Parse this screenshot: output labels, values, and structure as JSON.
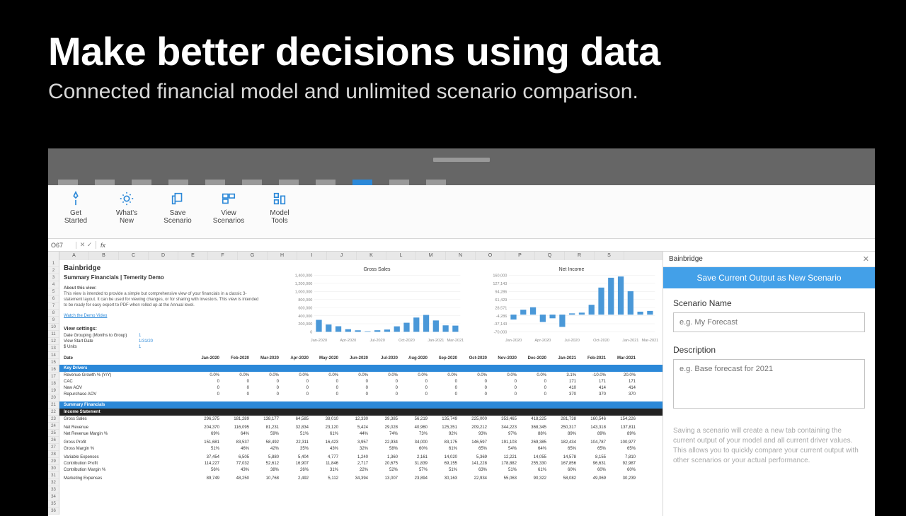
{
  "hero": {
    "title": "Make better decisions using data",
    "subtitle": "Connected financial model and unlimited scenario comparison."
  },
  "ribbon": {
    "items": [
      {
        "label": "Get\nStarted",
        "icon": "rocket"
      },
      {
        "label": "What's\nNew",
        "icon": "gear"
      },
      {
        "label": "Save\nScenario",
        "icon": "copy"
      },
      {
        "label": "View\nScenarios",
        "icon": "screens"
      },
      {
        "label": "Model\nTools",
        "icon": "tools"
      }
    ]
  },
  "fx": {
    "cell": "O67",
    "label": "fx"
  },
  "cols": [
    "A",
    "B",
    "C",
    "D",
    "E",
    "F",
    "G",
    "H",
    "I",
    "J",
    "K",
    "L",
    "M",
    "N",
    "O",
    "P",
    "Q",
    "R",
    "S"
  ],
  "sheet": {
    "brand": "Bainbridge",
    "subtitle": "Summary Financials | Temerity Demo",
    "about_title": "About this view:",
    "about_body": "This view is intended to provide a simple but comprehensive view of your financials in a classic 3-statement layout. It can be used for viewing changes, or for sharing with investors. This view is intended to be ready for easy export to PDF when rolled up at the Annual level.",
    "link": "Watch the Demo Video",
    "view_settings_title": "View settings:",
    "settings": [
      {
        "k": "Date Grouping (Months to Group)",
        "v": "1"
      },
      {
        "k": "View Start Date",
        "v": "1/31/20"
      },
      {
        "k": "$ Units",
        "v": "1"
      }
    ],
    "date_label": "Date",
    "dates": [
      "Jan-2020",
      "Feb-2020",
      "Mar-2020",
      "Apr-2020",
      "May-2020",
      "Jun-2020",
      "Jul-2020",
      "Aug-2020",
      "Sep-2020",
      "Oct-2020",
      "Nov-2020",
      "Dec-2020",
      "Jan-2021",
      "Feb-2021",
      "Mar-2021"
    ],
    "band_keydrivers": "Key Drivers",
    "kd_rows": [
      {
        "l": "Revenue Growth % (Y/Y)",
        "v": [
          "0.0%",
          "0.0%",
          "0.0%",
          "0.0%",
          "0.0%",
          "0.0%",
          "0.0%",
          "0.0%",
          "0.0%",
          "0.0%",
          "0.0%",
          "0.0%",
          "3.1%",
          "-10.0%",
          "20.0%"
        ]
      },
      {
        "l": "CAC",
        "v": [
          "0",
          "0",
          "0",
          "0",
          "0",
          "0",
          "0",
          "0",
          "0",
          "0",
          "0",
          "0",
          "171",
          "171",
          "171"
        ]
      },
      {
        "l": "New AOV",
        "v": [
          "0",
          "0",
          "0",
          "0",
          "0",
          "0",
          "0",
          "0",
          "0",
          "0",
          "0",
          "0",
          "410",
          "414",
          "414"
        ]
      },
      {
        "l": "Repurchase AOV",
        "v": [
          "0",
          "0",
          "0",
          "0",
          "0",
          "0",
          "0",
          "0",
          "0",
          "0",
          "0",
          "0",
          "370",
          "370",
          "370"
        ]
      }
    ],
    "band_sf": "Summary Financials",
    "band_is": "Income Statement",
    "row_gs": {
      "l": "Gross Sales",
      "v": [
        "296,375",
        "181,289",
        "138,177",
        "64,585",
        "38,010",
        "12,330",
        "39,385",
        "56,219",
        "135,749",
        "225,000",
        "353,465",
        "418,225",
        "281,738",
        "160,546",
        "154,226"
      ]
    },
    "row_nr": {
      "l": "Net Revenue",
      "v": [
        "204,370",
        "116,095",
        "81,231",
        "32,834",
        "23,120",
        "5,424",
        "29,028",
        "40,960",
        "125,351",
        "209,212",
        "344,223",
        "368,345",
        "250,317",
        "143,318",
        "137,811"
      ]
    },
    "row_nrm": {
      "l": "Net Revenue Margin %",
      "v": [
        "69%",
        "64%",
        "59%",
        "51%",
        "61%",
        "44%",
        "74%",
        "73%",
        "92%",
        "93%",
        "97%",
        "88%",
        "89%",
        "89%",
        "89%"
      ]
    },
    "row_gp": {
      "l": "Gross Profit",
      "v": [
        "151,681",
        "83,537",
        "58,492",
        "22,311",
        "16,423",
        "3,957",
        "22,934",
        "34,000",
        "83,175",
        "146,597",
        "191,103",
        "269,385",
        "182,434",
        "104,787",
        "100,977"
      ]
    },
    "row_gm": {
      "l": "Gross Margin %",
      "v": [
        "51%",
        "46%",
        "42%",
        "35%",
        "43%",
        "32%",
        "58%",
        "60%",
        "61%",
        "65%",
        "54%",
        "64%",
        "65%",
        "65%",
        "65%"
      ]
    },
    "row_ve": {
      "l": "Variable Expenses",
      "v": [
        "37,454",
        "6,505",
        "5,880",
        "5,404",
        "4,777",
        "1,240",
        "1,360",
        "2,161",
        "14,020",
        "5,369",
        "12,221",
        "14,055",
        "14,578",
        "8,155",
        "7,810"
      ]
    },
    "row_cp": {
      "l": "Contribution Profit",
      "v": [
        "114,227",
        "77,032",
        "52,612",
        "16,907",
        "11,846",
        "2,717",
        "20,675",
        "31,839",
        "69,155",
        "141,228",
        "178,882",
        "255,330",
        "167,856",
        "96,631",
        "92,987"
      ]
    },
    "row_cm": {
      "l": "Contribution Margin %",
      "v": [
        "56%",
        "43%",
        "38%",
        "26%",
        "31%",
        "22%",
        "52%",
        "57%",
        "51%",
        "63%",
        "51%",
        "61%",
        "60%",
        "60%",
        "60%"
      ]
    },
    "row_me": {
      "l": "Marketing Expenses",
      "v": [
        "89,749",
        "48,250",
        "10,768",
        "2,492",
        "5,112",
        "34,394",
        "13,007",
        "23,894",
        "30,163",
        "22,934",
        "55,063",
        "90,322",
        "58,082",
        "49,069",
        "30,239"
      ]
    }
  },
  "charts": {
    "gs": {
      "title": "Gross Sales"
    },
    "ni": {
      "title": "Net Income"
    }
  },
  "chart_data": [
    {
      "type": "bar",
      "title": "Gross Sales",
      "xlabel": "",
      "ylabel": "",
      "ylim": [
        0,
        1400000
      ],
      "yticks": [
        0,
        200000,
        400000,
        600000,
        800000,
        1000000,
        1200000,
        1400000
      ],
      "categories": [
        "Jan-2020",
        "Feb-2020",
        "Mar-2020",
        "Apr-2020",
        "May-2020",
        "Jun-2020",
        "Jul-2020",
        "Aug-2020",
        "Sep-2020",
        "Oct-2020",
        "Nov-2020",
        "Dec-2020",
        "Jan-2021",
        "Feb-2021",
        "Mar-2021"
      ],
      "values": [
        296375,
        181289,
        138177,
        64585,
        38010,
        12330,
        39385,
        56219,
        135749,
        225000,
        353465,
        418225,
        281738,
        160546,
        154226
      ]
    },
    {
      "type": "bar",
      "title": "Net Income",
      "xlabel": "",
      "ylabel": "",
      "ylim": [
        -70000,
        160000
      ],
      "yticks": [
        -40000,
        -20000,
        0,
        40000,
        80000,
        100000,
        140000,
        160000
      ],
      "categories": [
        "Jan-2020",
        "Feb-2020",
        "Mar-2020",
        "Apr-2020",
        "May-2020",
        "Jun-2020",
        "Jul-2020",
        "Aug-2020",
        "Sep-2020",
        "Oct-2020",
        "Nov-2020",
        "Dec-2020",
        "Jan-2021",
        "Feb-2021",
        "Mar-2021"
      ],
      "values": [
        -20000,
        20000,
        30000,
        -30000,
        -15000,
        -50000,
        5000,
        8000,
        40000,
        110000,
        150000,
        155000,
        95000,
        12000,
        15000
      ]
    }
  ],
  "panel": {
    "title": "Bainbridge",
    "cta": "Save Current Output as New Scenario",
    "name_label": "Scenario Name",
    "name_ph": "e.g. My Forecast",
    "desc_label": "Description",
    "desc_ph": "e.g. Base forecast for 2021",
    "help": "Saving a scenario will create a new tab containing the current output of your model and all current driver values. This allows you to quickly compare your current output with other scenarios or your actual performance."
  }
}
